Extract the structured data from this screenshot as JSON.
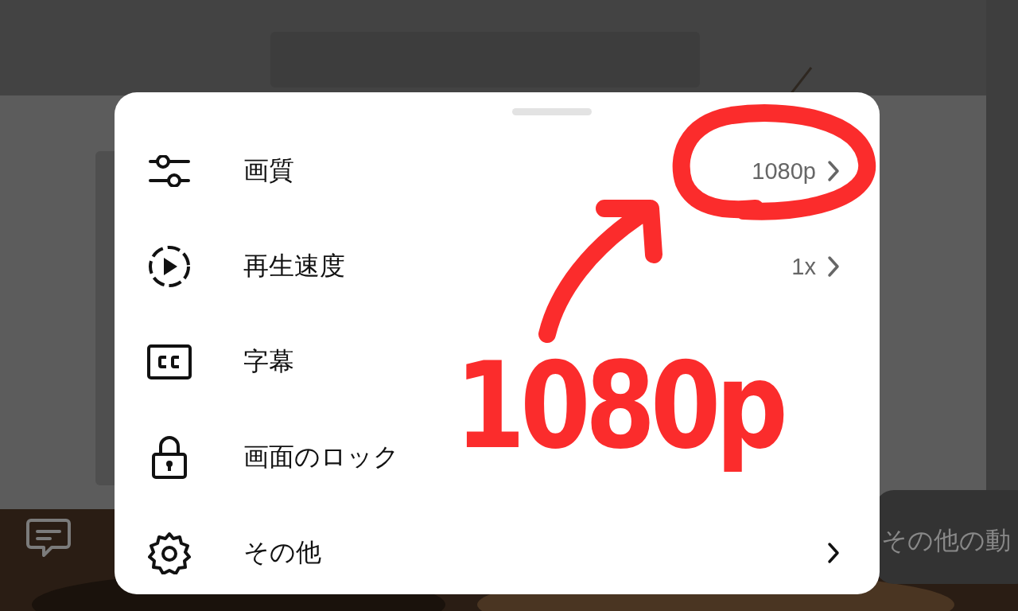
{
  "settings_sheet": {
    "items": [
      {
        "kind": "quality",
        "label": "画質",
        "value": "1080p",
        "submenu": true
      },
      {
        "kind": "speed",
        "label": "再生速度",
        "value": "1x",
        "submenu": true
      },
      {
        "kind": "captions",
        "label": "字幕",
        "submenu": false
      },
      {
        "kind": "lock",
        "label": "画面のロック",
        "submenu": false
      },
      {
        "kind": "more",
        "label": "その他",
        "submenu": true
      }
    ]
  },
  "more_videos": {
    "label": "その他の動"
  },
  "annotation": {
    "text": "1080p"
  }
}
